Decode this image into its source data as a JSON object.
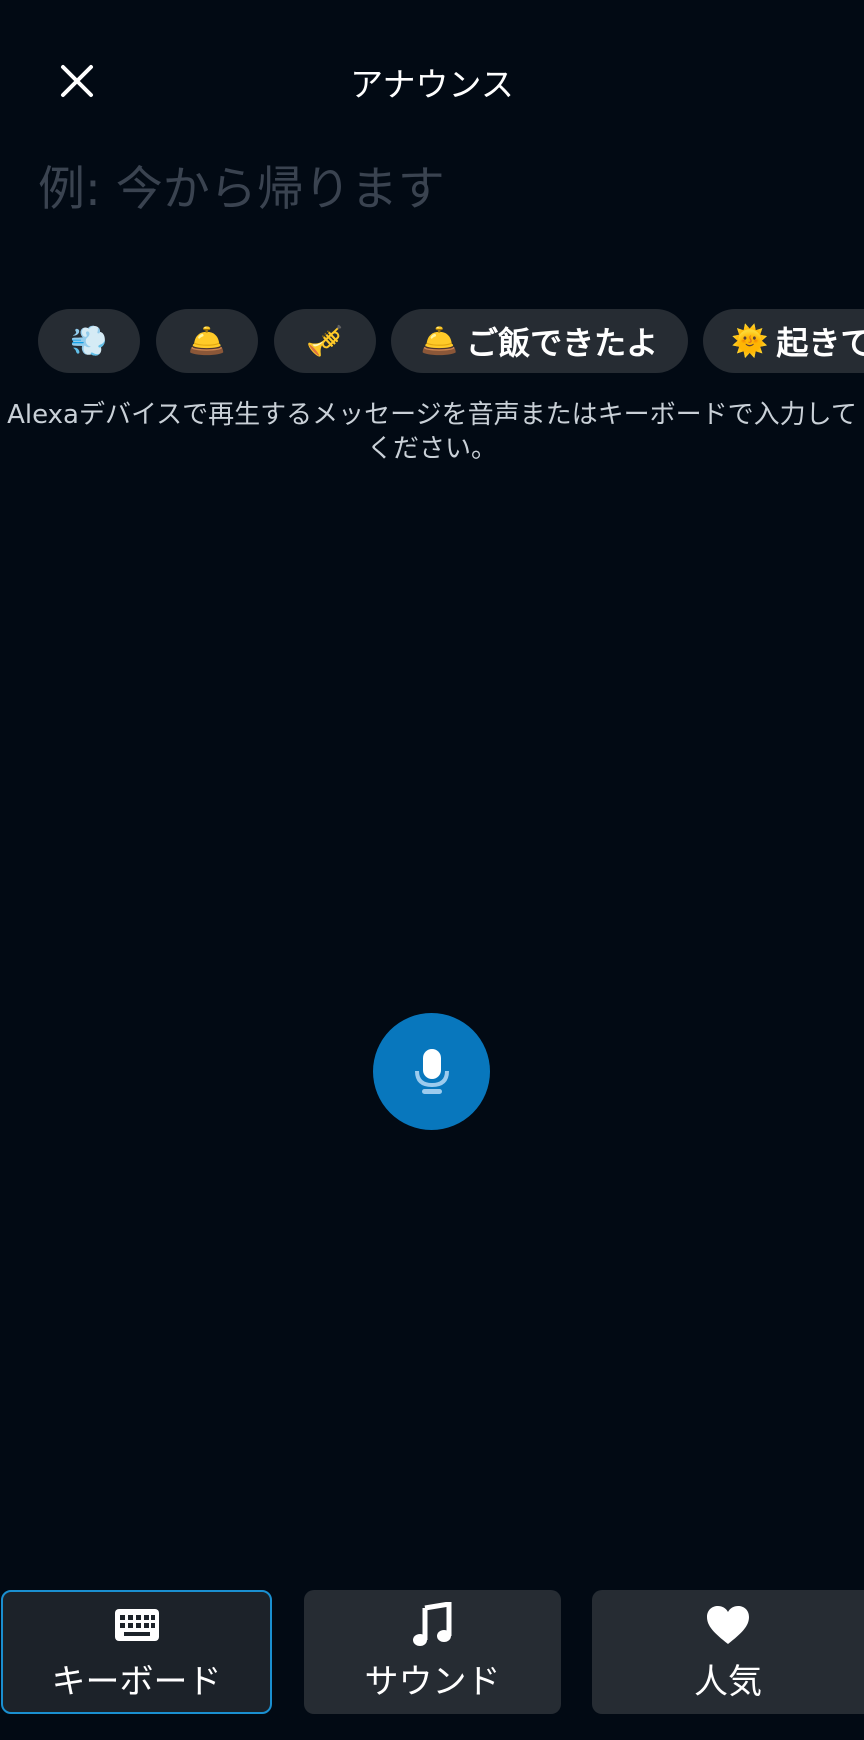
{
  "header": {
    "title": "アナウンス"
  },
  "message": {
    "placeholder": "例: 今から帰ります"
  },
  "chips": [
    {
      "emoji": "💨",
      "label": ""
    },
    {
      "emoji": "🛎️",
      "label": ""
    },
    {
      "emoji": "🎺",
      "label": ""
    },
    {
      "emoji": "🛎️",
      "label": "ご飯できたよ"
    },
    {
      "emoji": "🌞",
      "label": "起きて"
    }
  ],
  "instruction": {
    "line1": "Alexaデバイスで再生するメッセージを音声またはキーボードで入力して",
    "line2": "ください。"
  },
  "tabs": [
    {
      "label": "キーボード",
      "icon": "keyboard-icon"
    },
    {
      "label": "サウンド",
      "icon": "music-note-icon"
    },
    {
      "label": "人気",
      "icon": "heart-icon"
    }
  ],
  "colors": {
    "background": "#020a14",
    "accent": "#0877bd",
    "surface": "#262c33",
    "active_border": "#1a8fd0"
  }
}
